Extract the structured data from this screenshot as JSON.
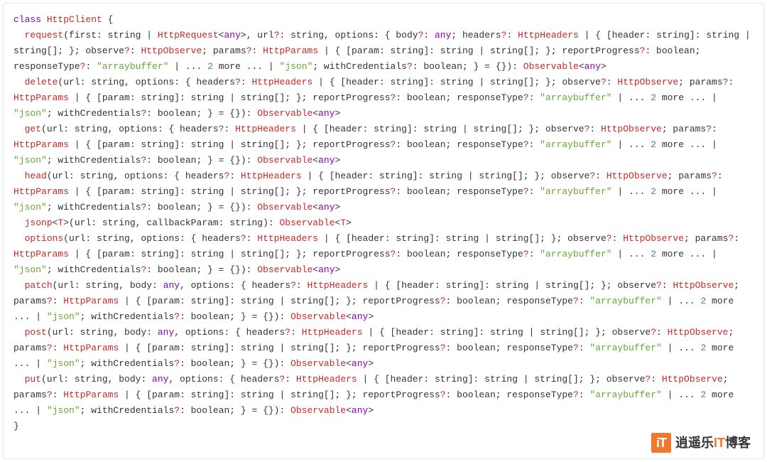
{
  "watermark": {
    "icon": "iT",
    "t1": "逍遥乐",
    "t2": "IT",
    "t3": "博客"
  },
  "code": {
    "line1_class": "class",
    "line1_name": "HttpClient",
    "line1_brace": " {",
    "req_ind": "  ",
    "req_name": "request",
    "req_a": "(first: string | ",
    "req_HttpRequest": "HttpRequest",
    "req_b": "<",
    "req_any1": "any",
    "req_c": ">, url",
    "req_q1": "?",
    "req_d": ": string, options: { body",
    "req_q2": "?",
    "req_e": ": ",
    "req_any2": "any",
    "req_f": "; headers",
    "req_q3": "?",
    "req_g": ": ",
    "req_HttpHeaders": "HttpHeaders",
    "req_h": " | { [header: string]: string | string[]; }; observe",
    "req_q4": "?",
    "req_i": ": ",
    "req_HttpObserve": "HttpObserve",
    "req_j": "; params",
    "req_q5": "?",
    "req_k": ": ",
    "req_HttpParams": "HttpParams",
    "req_l": " | { [param: string]: string | string[]; }; reportProgress",
    "req_q6": "?",
    "req_m": ": boolean; responseType",
    "req_q7": "?",
    "req_n": ": ",
    "req_str1": "\"arraybuffer\"",
    "req_o": " | ... ",
    "req_num1": "2",
    "req_p": " more ... | ",
    "req_str2": "\"json\"",
    "req_q": "; withCredentials",
    "req_q8": "?",
    "req_r": ": boolean; } = {}): ",
    "req_Obs": "Observable",
    "req_s": "<",
    "req_any3": "any",
    "req_t": ">",
    "del_ind": "  ",
    "del_name": "delete",
    "del_a": "(url: string, options: { headers",
    "del_q1": "?",
    "del_b": ": ",
    "del_HttpHeaders": "HttpHeaders",
    "del_c": " | { [header: string]: string | string[]; }; observe",
    "del_q2": "?",
    "del_d": ": ",
    "del_HttpObserve": "HttpObserve",
    "del_e": "; params",
    "del_q3": "?",
    "del_f": ": ",
    "del_HttpParams": "HttpParams",
    "del_g": " | { [param: string]: string | string[]; }; reportProgress",
    "del_q4": "?",
    "del_h": ": boolean; responseType",
    "del_q5": "?",
    "del_i": ": ",
    "del_str1": "\"arraybuffer\"",
    "del_j": " | ... ",
    "del_num1": "2",
    "del_k": " more ... | ",
    "del_str2": "\"json\"",
    "del_l": "; withCredentials",
    "del_q6": "?",
    "del_m": ": boolean; } = {}): ",
    "del_Obs": "Observable",
    "del_n": "<",
    "del_any": "any",
    "del_o": ">",
    "get_ind": "  ",
    "get_name": "get",
    "get_a": "(url: string, options: { headers",
    "get_q1": "?",
    "get_b": ": ",
    "get_HttpHeaders": "HttpHeaders",
    "get_c": " | { [header: string]: string | string[]; }; observe",
    "get_q2": "?",
    "get_d": ": ",
    "get_HttpObserve": "HttpObserve",
    "get_e": "; params",
    "get_q3": "?",
    "get_f": ": ",
    "get_HttpParams": "HttpParams",
    "get_g": " | { [param: string]: string | string[]; }; reportProgress",
    "get_q4": "?",
    "get_h": ": boolean; responseType",
    "get_q5": "?",
    "get_i": ": ",
    "get_str1": "\"arraybuffer\"",
    "get_j": " | ... ",
    "get_num1": "2",
    "get_k": " more ... | ",
    "get_str2": "\"json\"",
    "get_l": "; withCredentials",
    "get_q6": "?",
    "get_m": ": boolean; } = {}): ",
    "get_Obs": "Observable",
    "get_n": "<",
    "get_any": "any",
    "get_o": ">",
    "head_ind": "  ",
    "head_name": "head",
    "head_a": "(url: string, options: { headers",
    "head_q1": "?",
    "head_b": ": ",
    "head_HttpHeaders": "HttpHeaders",
    "head_c": " | { [header: string]: string | string[]; }; observe",
    "head_q2": "?",
    "head_d": ": ",
    "head_HttpObserve": "HttpObserve",
    "head_e": "; params",
    "head_q3": "?",
    "head_f": ": ",
    "head_HttpParams": "HttpParams",
    "head_g": " | { [param: string]: string | string[]; }; reportProgress",
    "head_q4": "?",
    "head_h": ": boolean; responseType",
    "head_q5": "?",
    "head_i": ": ",
    "head_str1": "\"arraybuffer\"",
    "head_j": " | ... ",
    "head_num1": "2",
    "head_k": " more ... | ",
    "head_str2": "\"json\"",
    "head_l": "; withCredentials",
    "head_q6": "?",
    "head_m": ": boolean; } = {}): ",
    "head_Obs": "Observable",
    "head_n": "<",
    "head_any": "any",
    "head_o": ">",
    "jsonp_ind": "  ",
    "jsonp_name": "jsonp",
    "jsonp_a": "<",
    "jsonp_T1": "T",
    "jsonp_b": ">(url: string, callbackParam: string): ",
    "jsonp_Obs": "Observable",
    "jsonp_c": "<",
    "jsonp_T2": "T",
    "jsonp_d": ">",
    "opt_ind": "  ",
    "opt_name": "options",
    "opt_a": "(url: string, options: { headers",
    "opt_q1": "?",
    "opt_b": ": ",
    "opt_HttpHeaders": "HttpHeaders",
    "opt_c": " | { [header: string]: string | string[]; }; observe",
    "opt_q2": "?",
    "opt_d": ": ",
    "opt_HttpObserve": "HttpObserve",
    "opt_e": "; params",
    "opt_q3": "?",
    "opt_f": ": ",
    "opt_HttpParams": "HttpParams",
    "opt_g": " | { [param: string]: string | string[]; }; reportProgress",
    "opt_q4": "?",
    "opt_h": ": boolean; responseType",
    "opt_q5": "?",
    "opt_i": ": ",
    "opt_str1": "\"arraybuffer\"",
    "opt_j": " | ... ",
    "opt_num1": "2",
    "opt_k": " more ... | ",
    "opt_str2": "\"json\"",
    "opt_l": "; withCredentials",
    "opt_q6": "?",
    "opt_m": ": boolean; } = {}): ",
    "opt_Obs": "Observable",
    "opt_n": "<",
    "opt_any": "any",
    "opt_o": ">",
    "patch_ind": "  ",
    "patch_name": "patch",
    "patch_a": "(url: string, body: ",
    "patch_any0": "any",
    "patch_b": ", options: { headers",
    "patch_q1": "?",
    "patch_c": ": ",
    "patch_HttpHeaders": "HttpHeaders",
    "patch_d": " | { [header: string]: string | string[]; }; observe",
    "patch_q2": "?",
    "patch_e": ": ",
    "patch_HttpObserve": "HttpObserve",
    "patch_f": "; params",
    "patch_q3": "?",
    "patch_g": ": ",
    "patch_HttpParams": "HttpParams",
    "patch_h": " | { [param: string]: string | string[]; }; reportProgress",
    "patch_q4": "?",
    "patch_i": ": boolean; responseType",
    "patch_q5": "?",
    "patch_j": ": ",
    "patch_str1": "\"arraybuffer\"",
    "patch_k": " | ... ",
    "patch_num1": "2",
    "patch_l": " more ... | ",
    "patch_str2": "\"json\"",
    "patch_m": "; withCredentials",
    "patch_q6": "?",
    "patch_n": ": boolean; } = {}): ",
    "patch_Obs": "Observable",
    "patch_o": "<",
    "patch_any": "any",
    "patch_p": ">",
    "post_ind": "  ",
    "post_name": "post",
    "post_a": "(url: string, body: ",
    "post_any0": "any",
    "post_b": ", options: { headers",
    "post_q1": "?",
    "post_c": ": ",
    "post_HttpHeaders": "HttpHeaders",
    "post_d": " | { [header: string]: string | string[]; }; observe",
    "post_q2": "?",
    "post_e": ": ",
    "post_HttpObserve": "HttpObserve",
    "post_f": "; params",
    "post_q3": "?",
    "post_g": ": ",
    "post_HttpParams": "HttpParams",
    "post_h": " | { [param: string]: string | string[]; }; reportProgress",
    "post_q4": "?",
    "post_i": ": boolean; responseType",
    "post_q5": "?",
    "post_j": ": ",
    "post_str1": "\"arraybuffer\"",
    "post_k": " | ... ",
    "post_num1": "2",
    "post_l": " more ... | ",
    "post_str2": "\"json\"",
    "post_m": "; withCredentials",
    "post_q6": "?",
    "post_n": ": boolean; } = {}): ",
    "post_Obs": "Observable",
    "post_o": "<",
    "post_any": "any",
    "post_p": ">",
    "put_ind": "  ",
    "put_name": "put",
    "put_a": "(url: string, body: ",
    "put_any0": "any",
    "put_b": ", options: { headers",
    "put_q1": "?",
    "put_c": ": ",
    "put_HttpHeaders": "HttpHeaders",
    "put_d": " | { [header: string]: string | string[]; }; observe",
    "put_q2": "?",
    "put_e": ": ",
    "put_HttpObserve": "HttpObserve",
    "put_f": "; params",
    "put_q3": "?",
    "put_g": ": ",
    "put_HttpParams": "HttpParams",
    "put_h": " | { [param: string]: string | string[]; }; reportProgress",
    "put_q4": "?",
    "put_i": ": boolean; responseType",
    "put_q5": "?",
    "put_j": ": ",
    "put_str1": "\"arraybuffer\"",
    "put_k": " | ... ",
    "put_num1": "2",
    "put_l": " more ... | ",
    "put_str2": "\"json\"",
    "put_m": "; withCredentials",
    "put_q6": "?",
    "put_n": ": boolean; } = {}): ",
    "put_Obs": "Observable",
    "put_o": "<",
    "put_any": "any",
    "put_p": ">",
    "close_brace": "}"
  }
}
